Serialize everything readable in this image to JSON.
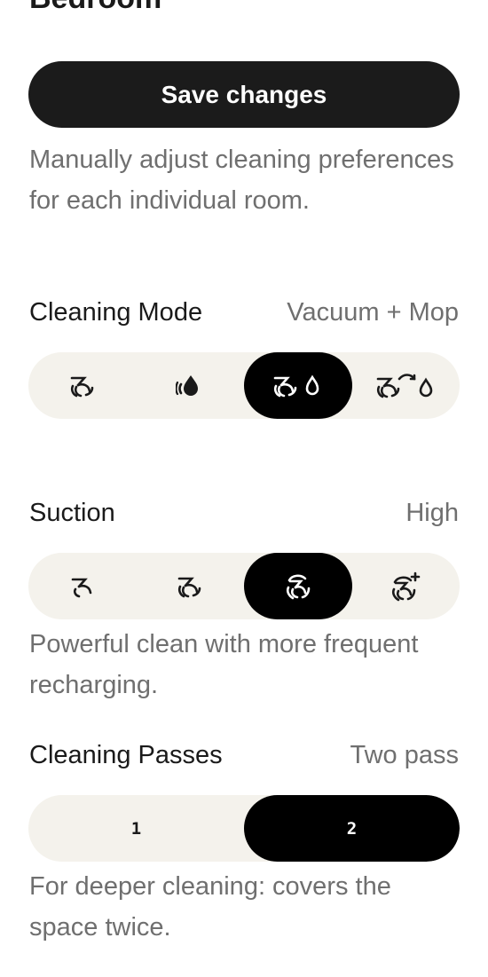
{
  "header": {
    "title": "Bedroom"
  },
  "actions": {
    "save_label": "Save changes"
  },
  "intro": {
    "description": "Manually adjust cleaning preferences for each individual room."
  },
  "cleaning_mode": {
    "label": "Cleaning Mode",
    "value": "Vacuum + Mop",
    "options": [
      {
        "icon": "vacuum-icon",
        "selected": false
      },
      {
        "icon": "mop-icon",
        "selected": false
      },
      {
        "icon": "vacuum-and-mop-icon",
        "selected": true
      },
      {
        "icon": "vacuum-then-mop-icon",
        "selected": false
      }
    ]
  },
  "suction": {
    "label": "Suction",
    "value": "High",
    "description": "Powerful clean with more frequent recharging.",
    "options": [
      {
        "icon": "suction-quiet-icon",
        "selected": false
      },
      {
        "icon": "suction-standard-icon",
        "selected": false
      },
      {
        "icon": "suction-high-icon",
        "selected": true
      },
      {
        "icon": "suction-max-icon",
        "selected": false
      }
    ]
  },
  "passes": {
    "label": "Cleaning Passes",
    "value": "Two pass",
    "description": "For deeper cleaning: covers the space twice.",
    "options": [
      {
        "label": "1",
        "selected": false
      },
      {
        "label": "2",
        "selected": true
      }
    ]
  },
  "colors": {
    "primary": "#1b1b1b",
    "segment_bg": "#f4f2ec",
    "selected_bg": "#000000",
    "muted_text": "#6f6f6f"
  }
}
